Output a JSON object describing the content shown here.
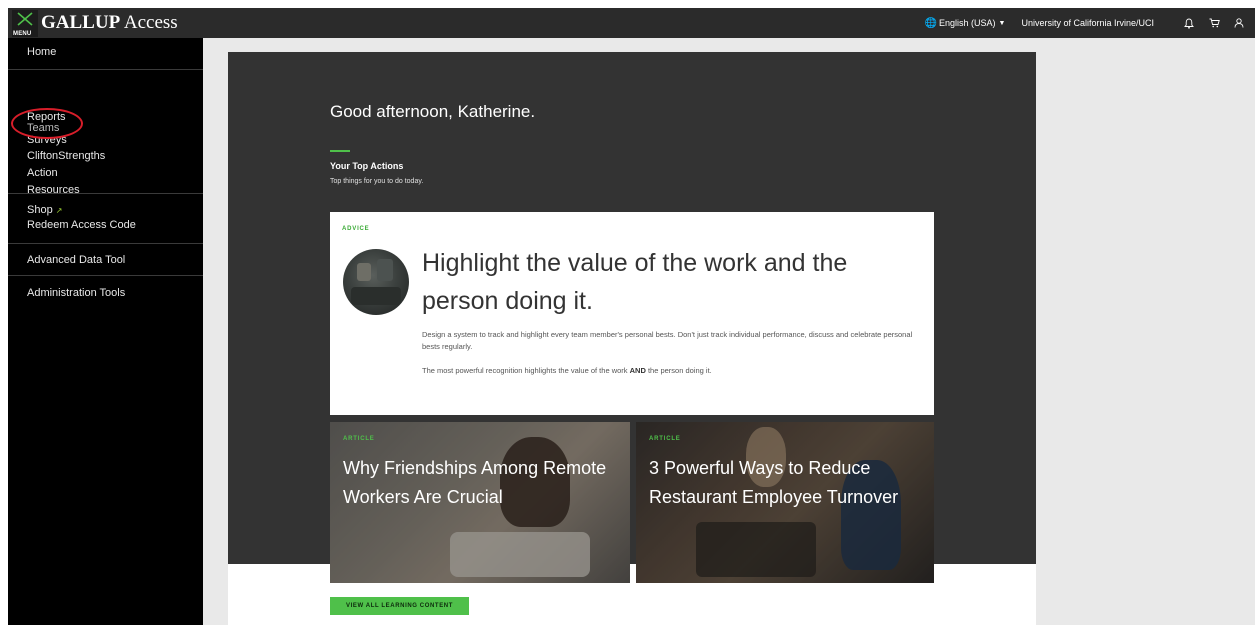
{
  "header": {
    "menu_label": "MENU",
    "brand_strong": "GALLUP",
    "brand_light": "Access",
    "language": "English (USA)",
    "organization": "University of California Irvine/UCI",
    "icons": [
      "bell-icon",
      "cart-icon",
      "user-icon"
    ]
  },
  "sidebar": {
    "groups": [
      {
        "items": [
          {
            "label": "Home"
          }
        ]
      },
      {
        "items": [
          {
            "label": "Reports"
          },
          {
            "label": "Teams"
          },
          {
            "label": "Surveys"
          },
          {
            "label": "CliftonStrengths"
          },
          {
            "label": "Action"
          },
          {
            "label": "Resources"
          }
        ]
      },
      {
        "items": [
          {
            "label": "Shop"
          },
          {
            "label": "Redeem Access Code"
          }
        ]
      },
      {
        "items": [
          {
            "label": "Advanced Data Tool"
          }
        ]
      },
      {
        "items": [
          {
            "label": "Administration Tools"
          }
        ]
      }
    ],
    "highlight_color": "#d81e2a"
  },
  "main": {
    "greeting": "Good afternoon, Katherine.",
    "top_actions_title": "Your Top Actions",
    "top_actions_subtitle": "Top things for you to do today.",
    "advice": {
      "tag": "ADVICE",
      "headline": "Highlight the value of the work and the person doing it.",
      "body": "Design a system to track and highlight every team member's personal bests. Don't just track individual performance, discuss and celebrate personal bests regularly.",
      "body2_pre": "The most powerful recognition highlights the value of the work ",
      "body2_bold": "AND",
      "body2_post": " the person doing it."
    },
    "articles": [
      {
        "tag": "ARTICLE",
        "title": "Why Friendships Among Remote Workers Are Crucial"
      },
      {
        "tag": "ARTICLE",
        "title": "3 Powerful Ways to Reduce Restaurant Employee Turnover"
      }
    ],
    "cta_label": "VIEW ALL LEARNING CONTENT"
  },
  "colors": {
    "accent_green": "#4fc04a",
    "panel_dark": "#333333",
    "sidebar_bg": "#000000",
    "topbar_bg": "#2b2b2b"
  }
}
